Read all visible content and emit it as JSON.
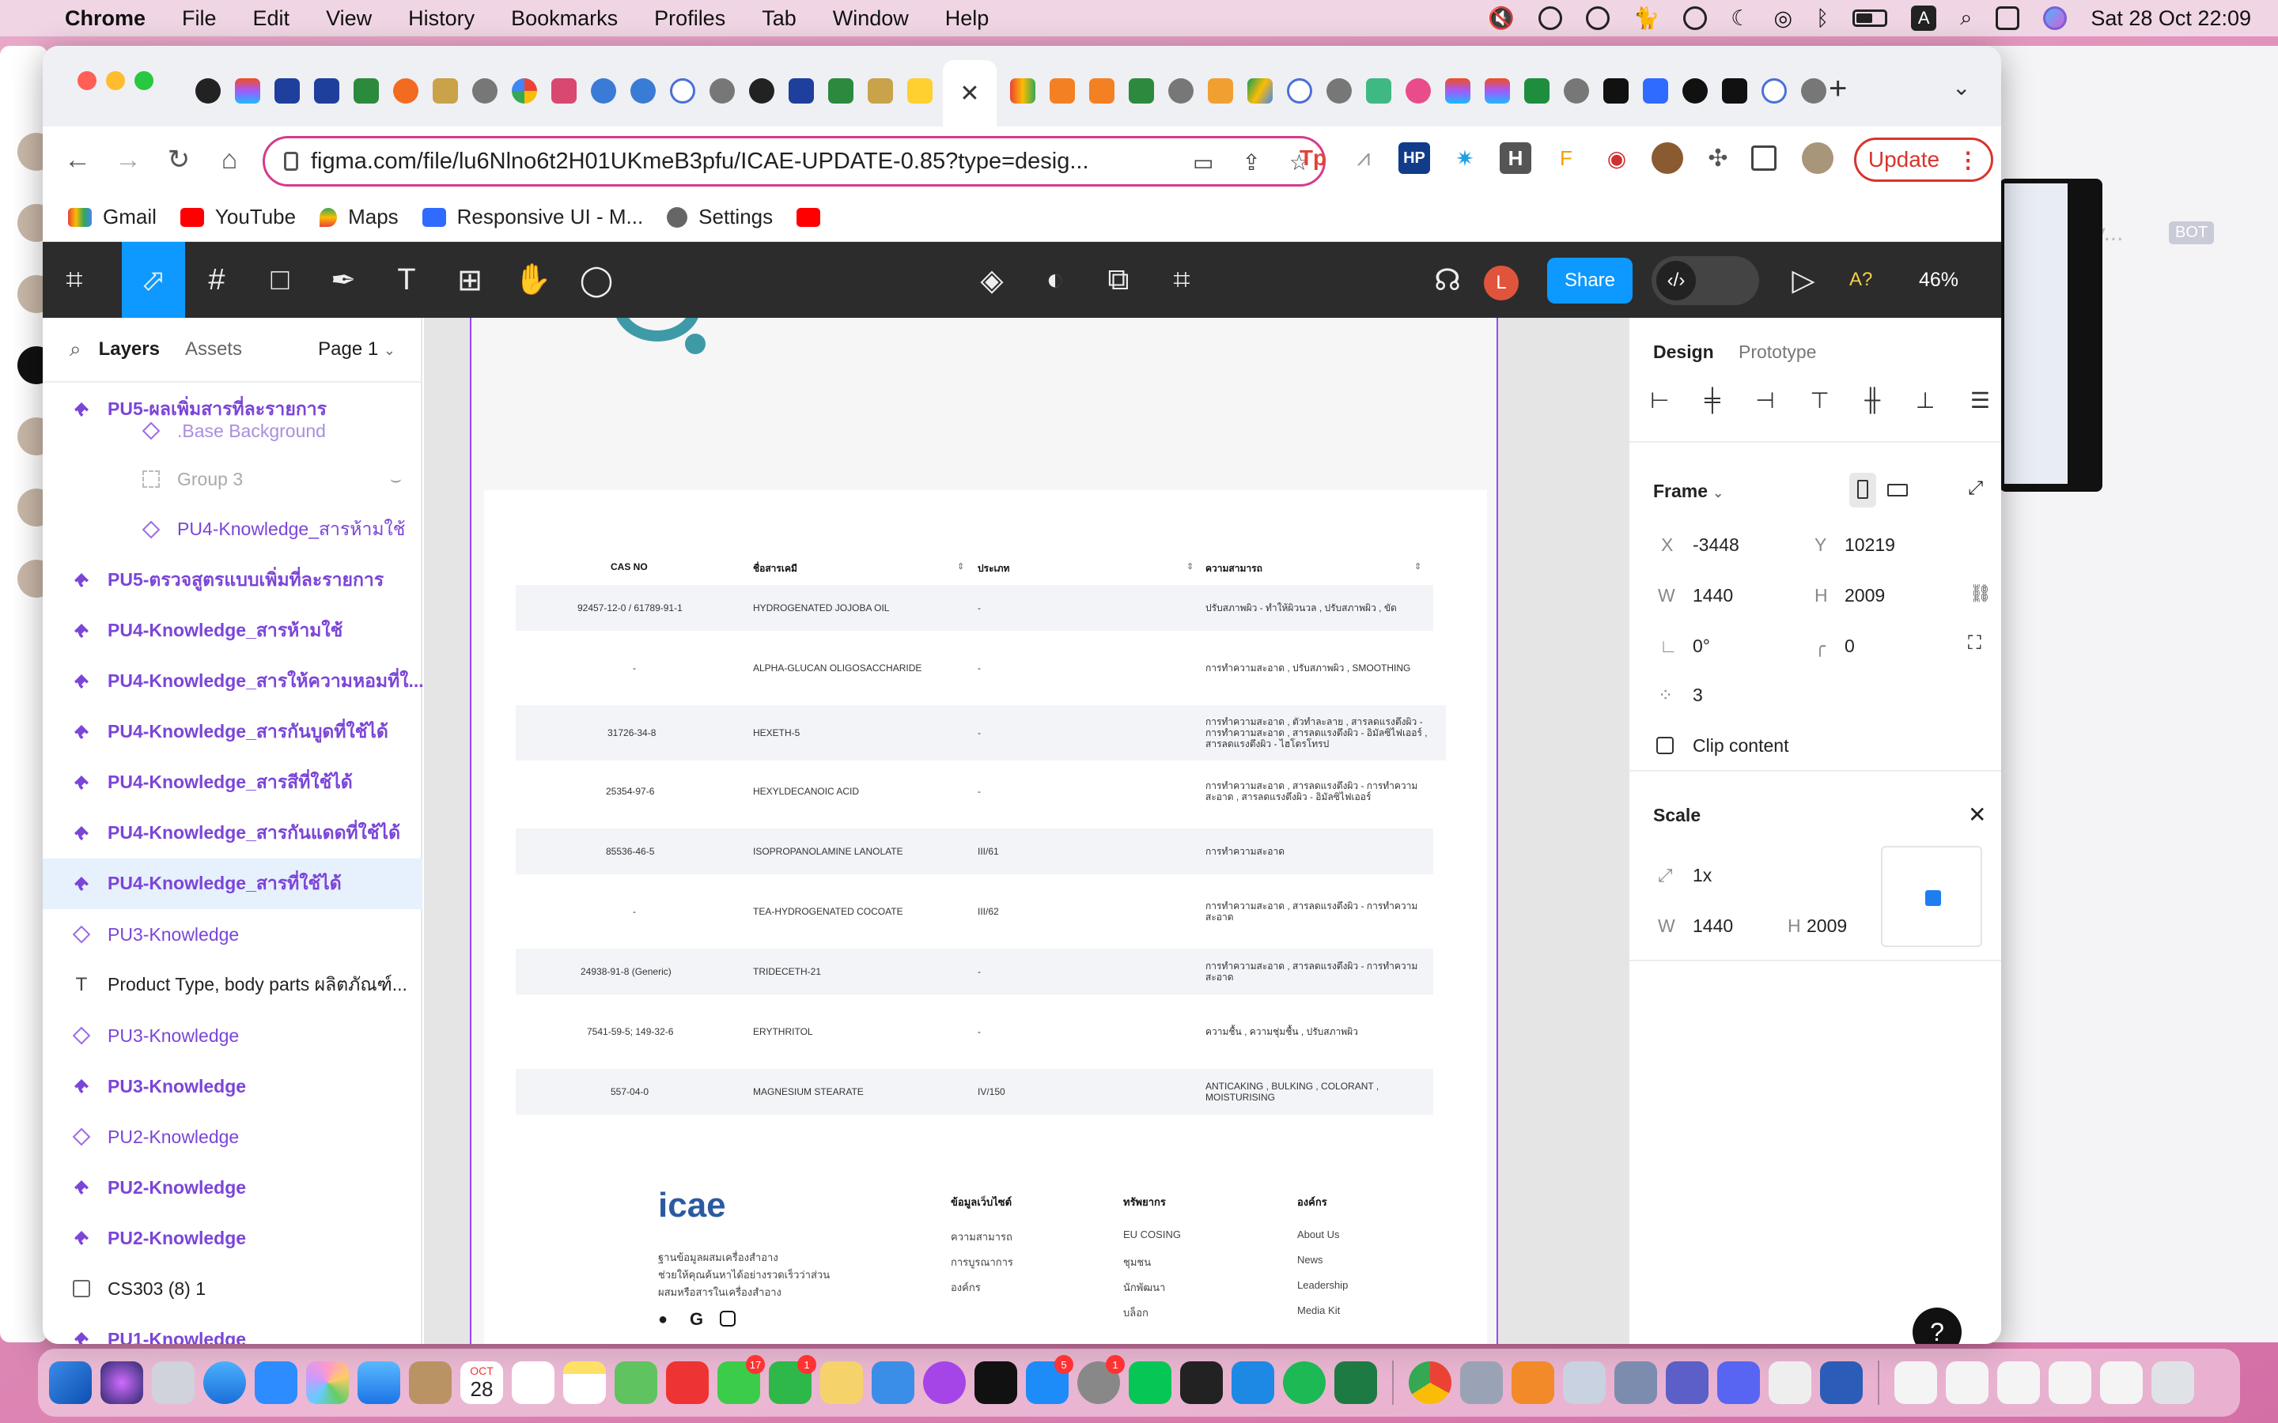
{
  "menubar": {
    "app": "Chrome",
    "items": [
      "File",
      "Edit",
      "View",
      "History",
      "Bookmarks",
      "Profiles",
      "Tab",
      "Window",
      "Help"
    ],
    "status_a": "A",
    "datetime": "Sat 28 Oct  22:09"
  },
  "browser": {
    "url": "figma.com/file/lu6Nlno6t2H01UKmeB3pfu/ICAE-UPDATE-0.85?type=desig...",
    "update_label": "Update",
    "ext_hp": "HP",
    "ext_h": "H",
    "ext_tp": "Tp",
    "active_tab_close": "✕",
    "new_tab": "+",
    "tab_list": "⌄",
    "bookmarks": [
      "Gmail",
      "YouTube",
      "Maps",
      "Responsive UI - M...",
      "Settings"
    ]
  },
  "figma": {
    "share_label": "Share",
    "avatar_initial": "L",
    "zoom": "46%",
    "font_warning": "A?",
    "layers_tab": "Layers",
    "assets_tab": "Assets",
    "page_selector": "Page 1",
    "layers": [
      {
        "name": "PU5-ผลเพิ่มสารที่ละรายการ",
        "type": "component-set"
      },
      {
        "name": ".Base Background",
        "type": "instance"
      },
      {
        "name": "Group 3",
        "type": "group"
      },
      {
        "name": "PU4-Knowledge_สารห้ามใช้",
        "type": "instance"
      },
      {
        "name": "PU5-ตรวจสูตรแบบเพิ่มที่ละรายการ",
        "type": "component-set"
      },
      {
        "name": "PU4-Knowledge_สารห้ามใช้",
        "type": "component-set"
      },
      {
        "name": "PU4-Knowledge_สารให้ความหอมที่ใ...",
        "type": "component-set"
      },
      {
        "name": "PU4-Knowledge_สารกันบูดที่ใช้ได้",
        "type": "component-set"
      },
      {
        "name": "PU4-Knowledge_สารสีที่ใช้ได้",
        "type": "component-set"
      },
      {
        "name": "PU4-Knowledge_สารกันแดดที่ใช้ได้",
        "type": "component-set"
      },
      {
        "name": "PU4-Knowledge_สารที่ใช้ได้",
        "type": "component-set"
      },
      {
        "name": "PU3-Knowledge",
        "type": "instance"
      },
      {
        "name": "Product Type, body parts ผลิตภัณฑ์...",
        "type": "text"
      },
      {
        "name": "PU3-Knowledge",
        "type": "instance"
      },
      {
        "name": "PU3-Knowledge",
        "type": "component-set"
      },
      {
        "name": "PU2-Knowledge",
        "type": "instance"
      },
      {
        "name": "PU2-Knowledge",
        "type": "component-set"
      },
      {
        "name": "PU2-Knowledge",
        "type": "component-set"
      },
      {
        "name": "CS303 (8) 1",
        "type": "image"
      },
      {
        "name": "PU1-Knowledge",
        "type": "component-set"
      }
    ],
    "design": {
      "tab_design": "Design",
      "tab_prototype": "Prototype",
      "frame_label": "Frame",
      "x_label": "X",
      "x": "-3448",
      "y_label": "Y",
      "y": "10219",
      "w_label": "W",
      "w": "1440",
      "h_label": "H",
      "h": "2009",
      "rotation": "0°",
      "radius": "0",
      "points": "3",
      "clip_content": "Clip content",
      "scale_label": "Scale",
      "scale_value": "1x",
      "scale_w": "1440",
      "scale_h": "2009"
    }
  },
  "table": {
    "headers": [
      "CAS NO",
      "ชื่อสารเคมี",
      "ประเภท",
      "ความสามารถ"
    ],
    "rows": [
      {
        "cas": "92457-12-0 / 61789-91-1",
        "name": "HYDROGENATED JOJOBA OIL",
        "type": "-",
        "func": "ปรับสภาพผิว - ทำให้ผิวนวล , ปรับสภาพผิว , ขัด"
      },
      {
        "cas": "-",
        "name": "ALPHA-GLUCAN OLIGOSACCHARIDE",
        "type": "-",
        "func": "การทำความสะอาด ,  ปรับสภาพผิว , SMOOTHING"
      },
      {
        "cas": "31726-34-8",
        "name": "HEXETH-5",
        "type": "-",
        "func": "การทำความสะอาด , ตัวทำละลาย , สารลดแรงตึงผิว - การทำความสะอาด , สารลดแรงตึงผิว - อิมัลซิไฟเออร์ , สารลดแรงตึงผิว - ไฮโดรโทรป"
      },
      {
        "cas": "25354-97-6",
        "name": "HEXYLDECANOIC ACID",
        "type": "-",
        "func": "การทำความสะอาด , สารลดแรงตึงผิว - การทำความสะอาด , สารลดแรงตึงผิว - อิมัลซิไฟเออร์"
      },
      {
        "cas": "85536-46-5",
        "name": "ISOPROPANOLAMINE LANOLATE",
        "type": "III/61",
        "func": "การทำความสะอาด"
      },
      {
        "cas": "-",
        "name": "TEA-HYDROGENATED COCOATE",
        "type": "III/62",
        "func": "การทำความสะอาด , สารลดแรงตึงผิว - การทำความสะอาด"
      },
      {
        "cas": "24938-91-8 (Generic)",
        "name": "TRIDECETH-21",
        "type": "-",
        "func": "การทำความสะอาด , สารลดแรงตึงผิว - การทำความสะอาด"
      },
      {
        "cas": "7541-59-5; 149-32-6",
        "name": "ERYTHRITOL",
        "type": "-",
        "func": "ความชื้น , ความชุ่มชื้น , ปรับสภาพผิว"
      },
      {
        "cas": "557-04-0",
        "name": "MAGNESIUM STEARATE",
        "type": "IV/150",
        "func": "ANTICAKING , BULKING , COLORANT , MOISTURISING"
      }
    ]
  },
  "footer": {
    "logo": "icae",
    "tagline": [
      "ฐานข้อมูลผสมเครื่องสำอาง",
      "ช่วยให้คุณค้นหาได้อย่างรวดเร็วว่าส่วน",
      "ผสมหรือสารในเครื่องสำอาง"
    ],
    "col1_title": "ข้อมูลเว็บไซต์",
    "col1": [
      "ความสามารถ",
      "การบูรณาการ",
      "องค์กร"
    ],
    "col2_title": "ทรัพยากร",
    "col2": [
      "EU COSING",
      "ชุมชน",
      "นักพัฒนา",
      "บล็อก"
    ],
    "col3_title": "องค์กร",
    "col3": [
      "About Us",
      "News",
      "Leadership",
      "Media Kit"
    ]
  },
  "bg_window": {
    "hint": "ny...",
    "badge": "BOT"
  },
  "dock": {
    "date_month": "OCT",
    "date_day": "28",
    "badges": [
      "17",
      "1",
      "5",
      "1"
    ]
  },
  "colors": {
    "figma_purple": "#9747ff",
    "component_purple": "#7b45d8",
    "figma_blue": "#0d99ff",
    "figma_toolbar": "#2c2c2c",
    "chrome_update_red": "#d7352d",
    "omnibox_pink": "#d53b8c",
    "desktop_pink": "#d46fa6"
  }
}
